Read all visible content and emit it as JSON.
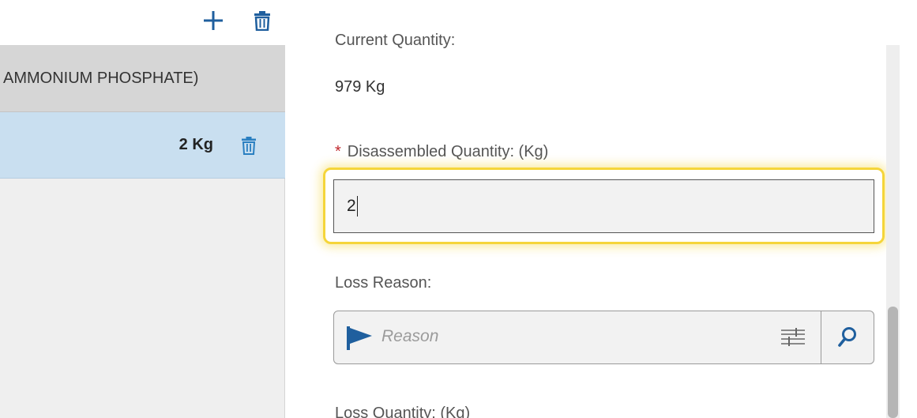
{
  "toolbar": {
    "add_icon": "plus-icon",
    "delete_icon": "trash-icon"
  },
  "list": {
    "group_header": "AMMONIUM PHOSPHATE)",
    "rows": [
      {
        "quantity": "2 Kg",
        "delete_icon": "trash-icon"
      }
    ]
  },
  "form": {
    "current_quantity_label": "Current Quantity:",
    "current_quantity_value": "979 Kg",
    "disassembled_required_marker": "*",
    "disassembled_label": "Disassembled Quantity: (Kg)",
    "disassembled_value": "2",
    "loss_reason_label": "Loss Reason:",
    "loss_reason_placeholder": "Reason",
    "loss_reason_icons": [
      "flag-icon",
      "filter-sliders-icon",
      "search-icon"
    ],
    "loss_quantity_label": "Loss Quantity: (Kg)"
  },
  "colors": {
    "accent_blue": "#1f5f9e",
    "selected_row": "#c9dff0",
    "focus_highlight": "#f5d53a",
    "required_star": "#c0282d"
  }
}
